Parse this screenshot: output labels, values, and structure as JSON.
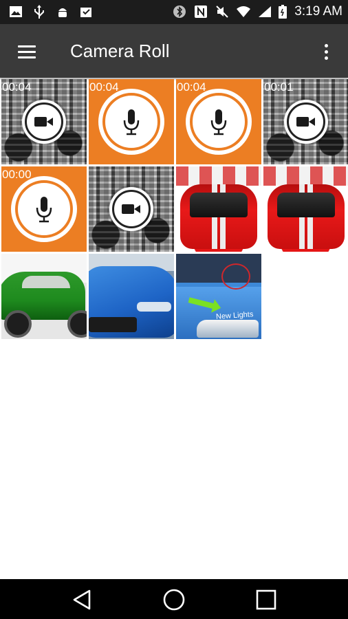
{
  "status_bar": {
    "time": "3:19 AM",
    "icons_left": [
      "image-icon",
      "usb-icon",
      "android-debug-icon",
      "download-done-icon"
    ],
    "icons_right": [
      "bluetooth-icon",
      "nfc-icon",
      "mute-icon",
      "wifi-icon",
      "signal-icon",
      "battery-icon"
    ]
  },
  "toolbar": {
    "title": "Camera Roll",
    "menu_icon": "hamburger-menu-icon",
    "overflow_icon": "more-vert-icon"
  },
  "gallery": {
    "items": [
      {
        "kind": "video",
        "duration": "00:04",
        "thumbnail": "engine"
      },
      {
        "kind": "audio",
        "duration": "00:04"
      },
      {
        "kind": "audio",
        "duration": "00:04"
      },
      {
        "kind": "video",
        "duration": "00:01",
        "thumbnail": "engine"
      },
      {
        "kind": "audio",
        "duration": "00:00"
      },
      {
        "kind": "video",
        "duration": "",
        "thumbnail": "engine"
      },
      {
        "kind": "photo",
        "thumbnail": "red-car"
      },
      {
        "kind": "photo",
        "thumbnail": "red-car"
      },
      {
        "kind": "photo",
        "thumbnail": "green-car"
      },
      {
        "kind": "photo",
        "thumbnail": "blue-car"
      },
      {
        "kind": "photo",
        "thumbnail": "blue-car-new-lights",
        "overlay_text": "New Lights"
      }
    ]
  },
  "nav_bar": {
    "back_icon": "back-triangle-icon",
    "home_icon": "home-circle-icon",
    "recents_icon": "recents-square-icon"
  },
  "colors": {
    "status_bar": "#1c1c1c",
    "toolbar": "#3a3a3a",
    "audio_tile": "#ec7e23",
    "nav_bar": "#000000"
  }
}
